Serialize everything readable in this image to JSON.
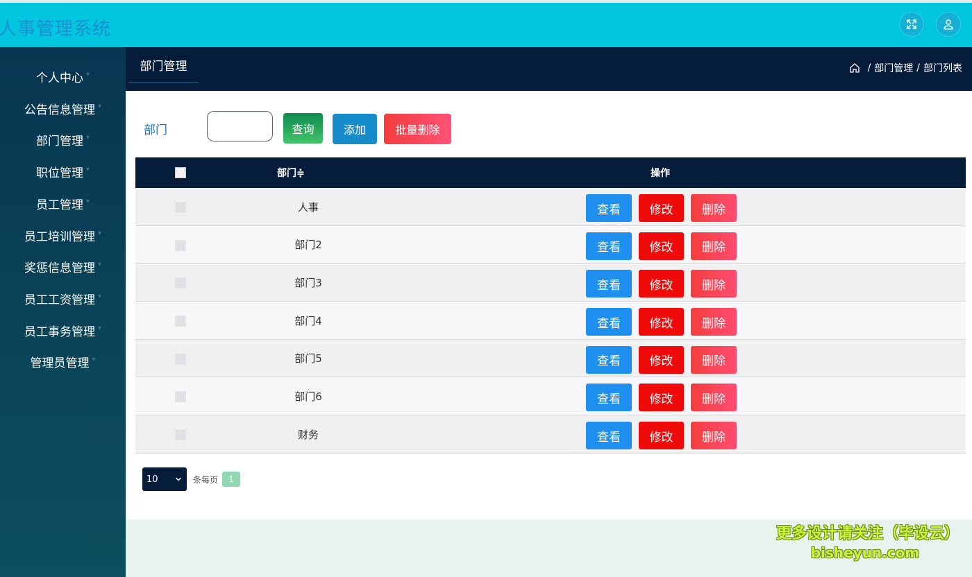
{
  "header": {
    "app_title": "人事管理系统",
    "fullscreen_icon": "expand-arrows-icon",
    "user_icon": "user-icon"
  },
  "sidebar": {
    "items": [
      {
        "label": "个人中心"
      },
      {
        "label": "公告信息管理"
      },
      {
        "label": "部门管理"
      },
      {
        "label": "职位管理"
      },
      {
        "label": "员工管理"
      },
      {
        "label": "员工培训管理"
      },
      {
        "label": "奖惩信息管理"
      },
      {
        "label": "员工工资管理"
      },
      {
        "label": "员工事务管理"
      },
      {
        "label": "管理员管理"
      }
    ]
  },
  "main": {
    "tab_label": "部门管理",
    "breadcrumb": {
      "home_icon": "home-icon",
      "sep": "/",
      "level1": "部门管理",
      "level2": "部门列表"
    }
  },
  "filter": {
    "label": "部门",
    "input_value": "",
    "query_label": "查询",
    "add_label": "添加",
    "batch_delete_label": "批量删除"
  },
  "table": {
    "columns": {
      "department": "部门≑",
      "actions": "操作"
    },
    "rows": [
      {
        "name": "人事"
      },
      {
        "name": "部门2"
      },
      {
        "name": "部门3"
      },
      {
        "name": "部门4"
      },
      {
        "name": "部门5"
      },
      {
        "name": "部门6"
      },
      {
        "name": "财务"
      }
    ],
    "actions": {
      "view": "查看",
      "edit": "修改",
      "delete": "删除"
    }
  },
  "pagination": {
    "page_size": "10",
    "per_page_label": "条每页",
    "current_page": "1"
  },
  "watermark": {
    "line1": "更多设计请关注（毕设云）",
    "line2": "bisheyun.com"
  }
}
